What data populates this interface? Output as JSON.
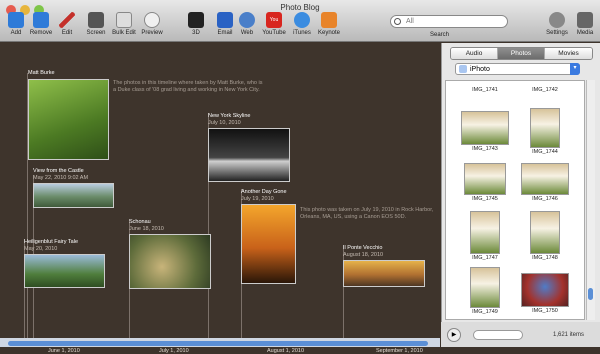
{
  "window": {
    "title": "Photo Blog"
  },
  "toolbar": {
    "add": "Add",
    "remove": "Remove",
    "edit": "Edit",
    "screen": "Screen",
    "bulk_edit": "Bulk Edit",
    "preview": "Preview",
    "three_d": "3D",
    "email": "Email",
    "web": "Web",
    "youtube": "YouTube",
    "itunes": "iTunes",
    "keynote": "Keynote",
    "settings": "Settings",
    "media": "Media",
    "search_placeholder": "All",
    "search_label": "Search",
    "youtube_logo": "You"
  },
  "timeline": {
    "ticks": [
      "June 1, 2010",
      "July 1, 2010",
      "August 1, 2010",
      "September 1, 2010"
    ],
    "items": [
      {
        "title": "Matt Burke",
        "date": "",
        "caption": "The photos in this timeline where taken by Matt Burke, who is a Duke class of '08 grad living and working in New York City."
      },
      {
        "title": "View from the Castle",
        "date": "May 22, 2010 9:02 AM"
      },
      {
        "title": "Heiligenblut Fairy Tale",
        "date": "May 20, 2010"
      },
      {
        "title": "Schonau",
        "date": "June 18, 2010"
      },
      {
        "title": "New York Skyline",
        "date": "July 10, 2010"
      },
      {
        "title": "Another Day Gone",
        "date": "July 19, 2010",
        "caption": "This photo was taken on July 19, 2010 in Rock Harbor, Orleans, MA, US, using a Canon EOS 50D."
      },
      {
        "title": "Il Ponte Vecchio",
        "date": "August 18, 2010"
      }
    ]
  },
  "sidebar": {
    "tabs": [
      "Audio",
      "Photos",
      "Movies"
    ],
    "source": "iPhoto",
    "thumbs": [
      "IMG_1741",
      "IMG_1742",
      "IMG_1743",
      "IMG_1744",
      "IMG_1745",
      "IMG_1746",
      "IMG_1747",
      "IMG_1748",
      "IMG_1749",
      "IMG_1750"
    ],
    "count": "1,621 items"
  }
}
